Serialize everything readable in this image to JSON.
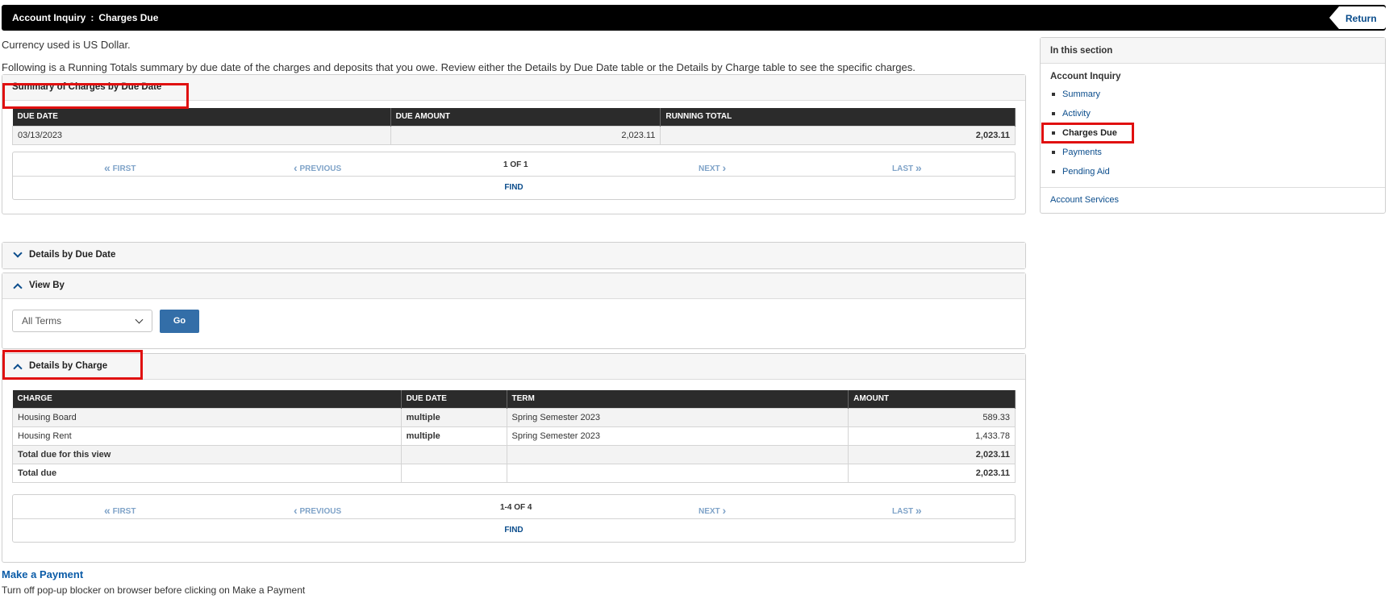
{
  "header": {
    "crumb1": "Account Inquiry",
    "crumb_sep": ":",
    "crumb2": "Charges Due",
    "return_label": "Return"
  },
  "intro": {
    "line1": "Currency used is US Dollar.",
    "line2": "Following is a Running Totals summary by due date of the charges and deposits that you owe.  Review either the Details by Due Date table or the Details by Charge table to see the specific charges."
  },
  "summary": {
    "title": "Summary of Charges by Due Date",
    "columns": [
      "DUE DATE",
      "DUE AMOUNT",
      "RUNNING TOTAL"
    ],
    "rows": [
      {
        "due_date": "03/13/2023",
        "due_amount": "2,023.11",
        "running_total": "2,023.11"
      }
    ],
    "pager": {
      "first": "FIRST",
      "previous": "PREVIOUS",
      "current": "1 OF 1",
      "next": "NEXT",
      "last": "LAST",
      "find": "FIND"
    }
  },
  "details_due_date": {
    "title": "Details by Due Date"
  },
  "view_by": {
    "title": "View By",
    "select_value": "All Terms",
    "go_label": "Go"
  },
  "details_charge": {
    "title": "Details by Charge",
    "columns": [
      "CHARGE",
      "DUE DATE",
      "TERM",
      "AMOUNT"
    ],
    "rows": [
      {
        "charge": "Housing Board",
        "due_date": "multiple",
        "term": "Spring Semester 2023",
        "amount": "589.33"
      },
      {
        "charge": "Housing Rent",
        "due_date": "multiple",
        "term": "Spring Semester 2023",
        "amount": "1,433.78"
      }
    ],
    "total_view_label": "Total due for this view",
    "total_view_amount": "2,023.11",
    "total_label": "Total due",
    "total_amount": "2,023.11",
    "pager": {
      "first": "FIRST",
      "previous": "PREVIOUS",
      "current": "1-4 OF 4",
      "next": "NEXT",
      "last": "LAST",
      "find": "FIND"
    }
  },
  "payment": {
    "link": "Make a Payment",
    "note": "Turn off pop-up blocker on browser before clicking on Make a Payment"
  },
  "sidebar": {
    "title": "In this section",
    "group": "Account Inquiry",
    "items": [
      {
        "label": "Summary"
      },
      {
        "label": "Activity"
      },
      {
        "label": "Charges Due"
      },
      {
        "label": "Payments"
      },
      {
        "label": "Pending Aid"
      }
    ],
    "services": "Account Services"
  },
  "icons": {
    "pager_first": "double-chevron-left-icon",
    "pager_prev": "chevron-left-icon",
    "pager_next": "chevron-right-icon",
    "pager_last": "double-chevron-right-icon",
    "section_toggle": "chevron-icon",
    "return": "back-arrow-icon"
  },
  "colors": {
    "link": "#0b4d8c",
    "highlight": "#e01010",
    "button": "#336ea8",
    "header": "#000000"
  }
}
